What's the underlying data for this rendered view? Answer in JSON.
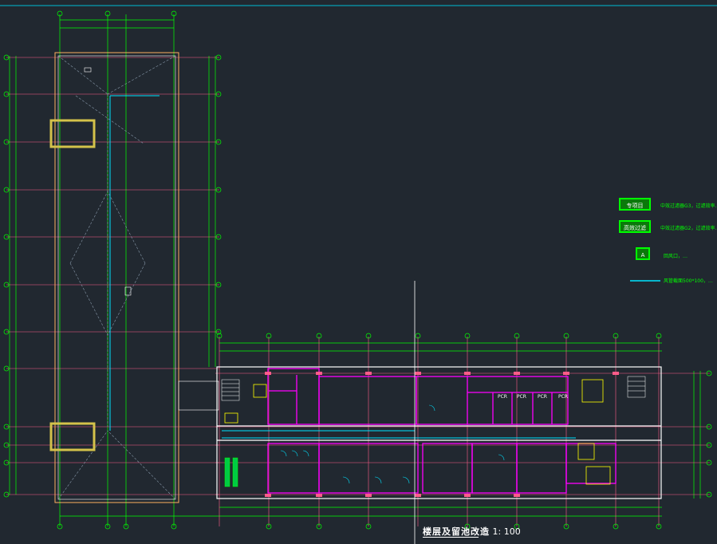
{
  "drawing": {
    "title": "楼层及留池改造",
    "scale": "1: 100",
    "colors": {
      "background": "#212830",
      "dimension": "#00ff00",
      "grid": "#ff5c8a",
      "wall": "#ff00ff",
      "outline": "#ffffff",
      "column": "#ffff00",
      "accent": "#00e5ff",
      "frame": "#00bcd4"
    }
  },
  "legend": {
    "items": [
      {
        "label": "专项目",
        "text": "中效过滤器G3，过滤效率…"
      },
      {
        "label": "高效过滤",
        "text": "中效过滤器G2，过滤效率…"
      },
      {
        "label": "A",
        "text": "回风口，…"
      },
      {
        "label": "",
        "text": "风管截面500*100，…"
      }
    ]
  },
  "room_labels": [
    "PCR",
    "PCR",
    "PCR",
    "PCR"
  ]
}
